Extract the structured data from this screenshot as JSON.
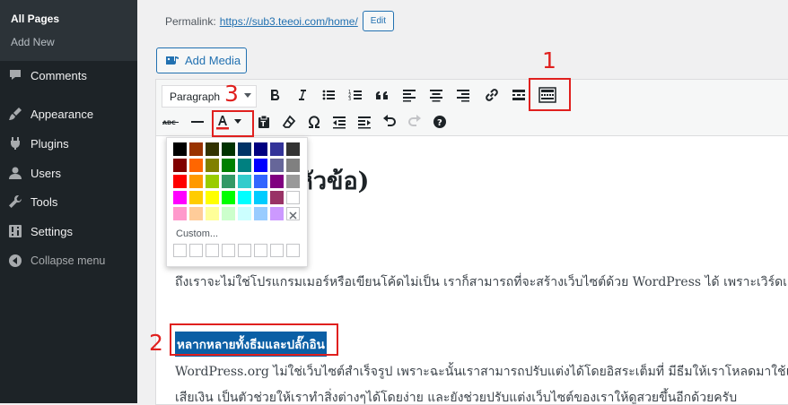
{
  "sidebar": {
    "submenu": [
      {
        "label": "All Pages",
        "current": true
      },
      {
        "label": "Add New",
        "current": false
      }
    ],
    "items": [
      {
        "label": "Comments",
        "icon": "comments-icon"
      },
      {
        "label": "Appearance",
        "icon": "appearance-icon"
      },
      {
        "label": "Plugins",
        "icon": "plugins-icon"
      },
      {
        "label": "Users",
        "icon": "users-icon"
      },
      {
        "label": "Tools",
        "icon": "tools-icon"
      },
      {
        "label": "Settings",
        "icon": "settings-icon"
      },
      {
        "label": "Collapse menu",
        "icon": "collapse-icon"
      }
    ]
  },
  "permalink": {
    "label": "Permalink:",
    "url": "https://sub3.teeoi.com/home/",
    "edit_label": "Edit"
  },
  "add_media": {
    "label": "Add Media"
  },
  "toolbar": {
    "format_value": "Paragraph"
  },
  "color_picker": {
    "custom_label": "Custom...",
    "colors": [
      [
        "#000000",
        "#993300",
        "#333300",
        "#003300",
        "#003366",
        "#000080",
        "#333399",
        "#333333"
      ],
      [
        "#800000",
        "#ff6600",
        "#808000",
        "#008000",
        "#008080",
        "#0000ff",
        "#666699",
        "#808080"
      ],
      [
        "#ff0000",
        "#ff9900",
        "#99cc00",
        "#339966",
        "#33cccc",
        "#3366ff",
        "#800080",
        "#999999"
      ],
      [
        "#ff00ff",
        "#ffcc00",
        "#ffff00",
        "#00ff00",
        "#00ffff",
        "#00ccff",
        "#993366",
        "#ffffff"
      ],
      [
        "#ff99cc",
        "#ffcc99",
        "#ffff99",
        "#ccffcc",
        "#ccffff",
        "#99ccff",
        "#cc99ff",
        "none"
      ]
    ]
  },
  "content": {
    "heading": "g (หัวข้อ)",
    "paragraph1": "ถึงเราจะไม่ใช่โปรแกรมเมอร์หรือเขียนโค้ดไม่เป็น เราก็สามารถที่จะสร้างเว็บไซต์ด้วย WordPress ได้ เพราะเวิร์ดเ",
    "highlight": "หลากหลายทั้งธีมและปลั๊กอิน",
    "paragraph2": "WordPress.org ไม่ใช่เว็บไซต์สำเร็จรูป เพราะฉะนั้นเราสามารถปรับแต่งได้โดยอิสระเต็มที่ มีธีมให้เราโหลดมาใช้แ",
    "paragraph3": "เสียเงิน เป็นตัวช่วยให้เราทำสิ่งต่างๆได้โดยง่าย และยังช่วยปรับแต่งเว็บไซต์ของเราให้ดูสวยขึ้นอีกด้วยครับ"
  },
  "annotations": {
    "a1": "1",
    "a2": "2",
    "a3": "3"
  },
  "colors": {
    "annotation": "#e0201e",
    "accent": "#2271b1",
    "sidebar_bg": "#1d2327"
  }
}
